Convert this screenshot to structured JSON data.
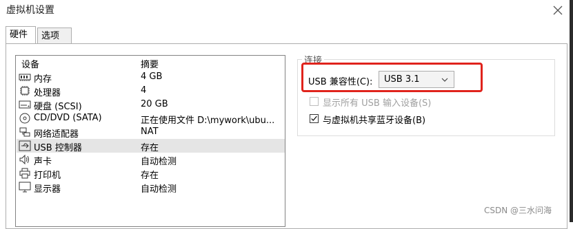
{
  "window": {
    "title": "虚拟机设置"
  },
  "tabs": [
    {
      "label": "硬件",
      "active": true
    },
    {
      "label": "选项",
      "active": false
    }
  ],
  "device_list": {
    "columns": [
      "设备",
      "摘要"
    ],
    "rows": [
      {
        "icon": "memory-icon",
        "name": "内存",
        "summary": "4 GB",
        "selected": false
      },
      {
        "icon": "cpu-icon",
        "name": "处理器",
        "summary": "4",
        "selected": false
      },
      {
        "icon": "hard-disk-icon",
        "name": "硬盘 (SCSI)",
        "summary": "20 GB",
        "selected": false
      },
      {
        "icon": "cd-dvd-icon",
        "name": "CD/DVD (SATA)",
        "summary": "正在使用文件 D:\\mywork\\ubu...",
        "selected": false
      },
      {
        "icon": "network-adapter-icon",
        "name": "网络适配器",
        "summary": "NAT",
        "selected": false
      },
      {
        "icon": "usb-controller-icon",
        "name": "USB 控制器",
        "summary": "存在",
        "selected": true
      },
      {
        "icon": "sound-card-icon",
        "name": "声卡",
        "summary": "自动检测",
        "selected": false
      },
      {
        "icon": "printer-icon",
        "name": "打印机",
        "summary": "存在",
        "selected": false
      },
      {
        "icon": "display-icon",
        "name": "显示器",
        "summary": "自动检测",
        "selected": false
      }
    ]
  },
  "connection": {
    "group_title": "连接",
    "usb_compat_label": "USB 兼容性(C):",
    "usb_compat_value": "USB 3.1",
    "show_all_usb_label": "显示所有 USB 输入设备(S)",
    "show_all_usb_checked": false,
    "show_all_usb_disabled": true,
    "share_bt_label": "与虚拟机共享蓝牙设备(B)",
    "share_bt_checked": true
  },
  "watermark": "CSDN @三水问海",
  "colors": {
    "highlight_box": "#e0231c",
    "selected_row": "#e5e5e5"
  }
}
